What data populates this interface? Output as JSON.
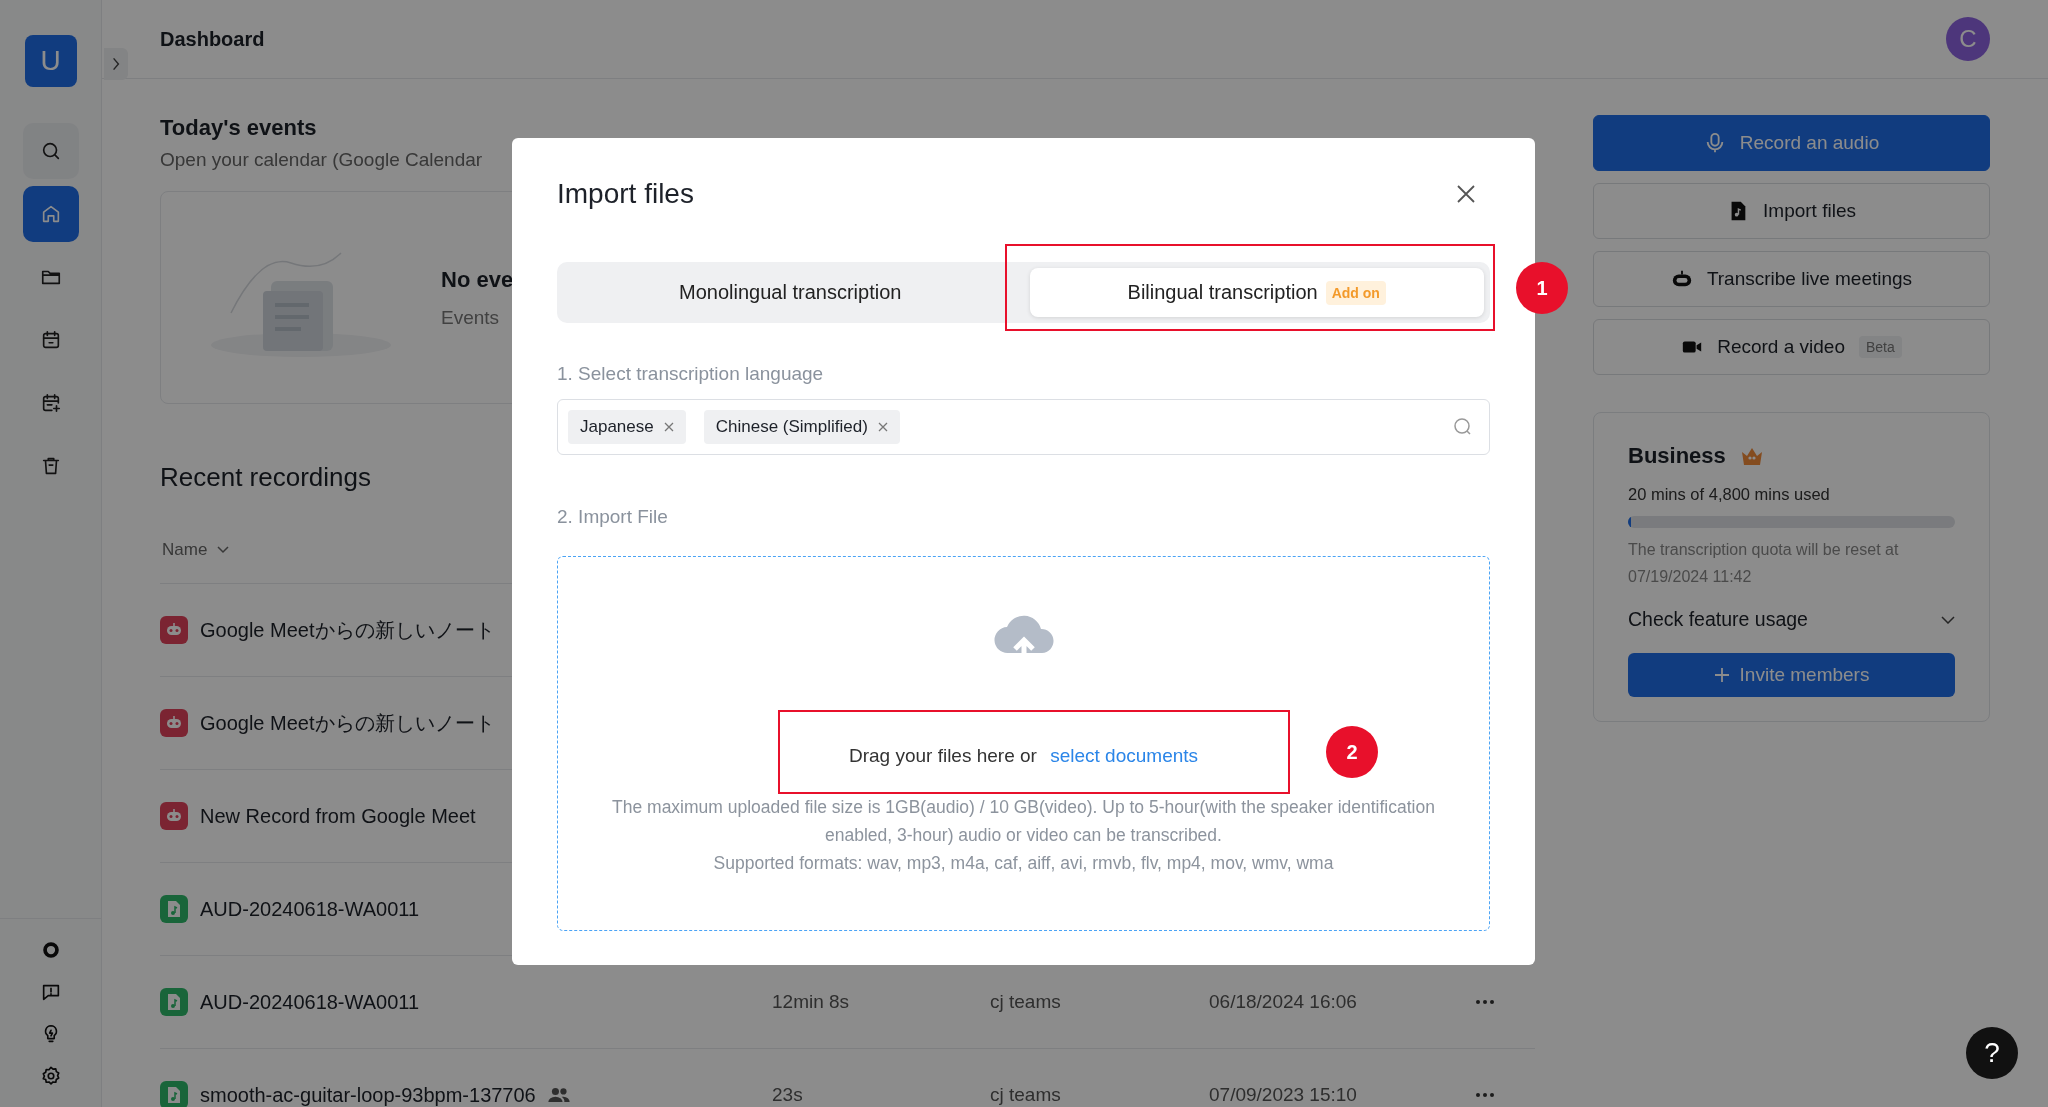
{
  "sidebar": {
    "logo": "U",
    "items": [
      {
        "kind": "search",
        "selected": false
      },
      {
        "kind": "home",
        "selected": true
      },
      {
        "kind": "folder",
        "selected": false
      },
      {
        "kind": "calendar",
        "selected": false
      },
      {
        "kind": "calendar-plus",
        "selected": false
      },
      {
        "kind": "trash",
        "selected": false
      }
    ],
    "bottom_items": [
      {
        "kind": "ring"
      },
      {
        "kind": "feedback"
      },
      {
        "kind": "bulb"
      },
      {
        "kind": "settings"
      }
    ]
  },
  "header": {
    "title": "Dashboard",
    "avatar": "C"
  },
  "events": {
    "title": "Today's events",
    "subtitle": "Open your calendar (Google Calendar",
    "empty_title": "No eve",
    "empty_text": "Events"
  },
  "recordings": {
    "title": "Recent recordings",
    "column_name": "Name",
    "rows": [
      {
        "kind": "meeting",
        "name": "Google Meetからの新しいノート",
        "shared": false
      },
      {
        "kind": "meeting",
        "name": "Google Meetからの新しいノート",
        "shared": false
      },
      {
        "kind": "meeting",
        "name": "New Record from Google Meet",
        "shared": false
      },
      {
        "kind": "audio",
        "name": "AUD-20240618-WA0011",
        "shared": false
      },
      {
        "kind": "audio",
        "name": "AUD-20240618-WA0011",
        "shared": false,
        "duration": "12min 8s",
        "owner": "cj teams",
        "date": "06/18/2024 16:06"
      },
      {
        "kind": "audio",
        "name": "smooth-ac-guitar-loop-93bpm-137706",
        "shared": true,
        "duration": "23s",
        "owner": "cj teams",
        "date": "07/09/2023 15:10"
      }
    ]
  },
  "actions": [
    {
      "kind": "audio",
      "label": "Record an audio",
      "primary": true
    },
    {
      "kind": "import",
      "label": "Import files",
      "primary": false
    },
    {
      "kind": "meeting",
      "label": "Transcribe live meetings",
      "primary": false
    },
    {
      "kind": "video",
      "label": "Record a video",
      "primary": false,
      "badge": "Beta"
    }
  ],
  "plan": {
    "name": "Business",
    "usage": "20 mins of 4,800 mins used",
    "level": 0.005,
    "reset_note": "The transcription quota will be reset at 07/19/2024 11:42",
    "feature_usage": "Check feature usage",
    "invite": "Invite members"
  },
  "help": "?",
  "modal": {
    "title": "Import files",
    "tabs": [
      {
        "label": "Monolingual transcription",
        "selected": false
      },
      {
        "label": "Bilingual transcription",
        "selected": true,
        "badge": "Add on"
      }
    ],
    "language_label": "1. Select transcription language",
    "languages": [
      "Japanese",
      "Chinese (Simplified)"
    ],
    "import_label": "2. Import File",
    "drop_text": "Drag your files here or",
    "drop_link": "select documents",
    "notes": [
      "The maximum uploaded file size is 1GB(audio) / 10 GB(video). Up to 5-hour(with the speaker identification enabled, 3-hour) audio or video can be transcribed.",
      "Supported formats: wav, mp3, m4a, caf, aiff, avi, rmvb, flv, mp4, mov, wmv, wma"
    ]
  },
  "annotations": [
    {
      "label": "1"
    },
    {
      "label": "2"
    }
  ]
}
